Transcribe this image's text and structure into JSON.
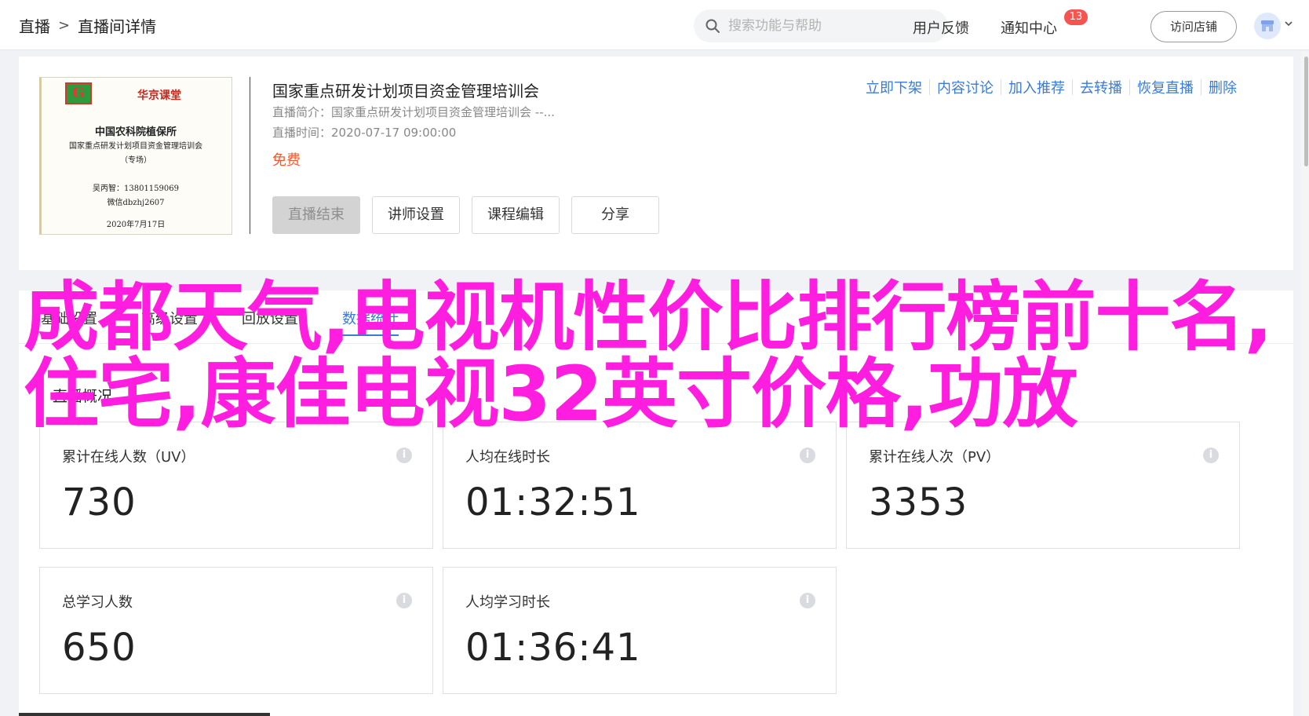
{
  "header": {
    "breadcrumb": [
      "直播",
      "直播间详情"
    ],
    "breadcrumb_sep": ">",
    "search_placeholder": "搜索功能与帮助",
    "feedback": "用户反馈",
    "notify": "通知中心",
    "notify_badge": "13",
    "visit_store": "访问店铺"
  },
  "course": {
    "cover": {
      "brand": "华京课堂",
      "org": "中国农科院植保所",
      "title": "国家重点研发计划项目资金管理培训会",
      "sub": "（专场）",
      "contact": "吴丙智：13801159069",
      "wechat": "微信dbzhj2607",
      "date": "2020年7月17日"
    },
    "title": "国家重点研发计划项目资金管理培训会",
    "intro_label": "直播简介：",
    "intro_value": "国家重点研发计划项目资金管理培训会 --...",
    "time_label": "直播时间：",
    "time_value": "2020-07-17 09:00:00",
    "price": "免费",
    "buttons": [
      "直播结束",
      "讲师设置",
      "课程编辑",
      "分享"
    ],
    "actions": [
      "立即下架",
      "内容讨论",
      "加入推荐",
      "去转播",
      "恢复直播",
      "删除"
    ]
  },
  "tabs": [
    "基础设置",
    "高级设置",
    "回放设置",
    "数据统计"
  ],
  "active_tab": 3,
  "section_title": "直播概况",
  "stats": [
    {
      "label": "累计在线人数（UV）",
      "value": "730"
    },
    {
      "label": "人均在线时长",
      "value": "01:32:51"
    },
    {
      "label": "累计在线人次（PV）",
      "value": "3353"
    },
    {
      "label": "总学习人数",
      "value": "650"
    },
    {
      "label": "人均学习时长",
      "value": "01:36:41"
    }
  ],
  "overlay_text": "成都天气,电视机性价比排行榜前十名,住宅,康佳电视32英寸价格,功放",
  "colors": {
    "accent": "#3a7bd5",
    "price": "#f25a30",
    "overlay": "#ff1ee0",
    "badge": "#f5544f"
  }
}
